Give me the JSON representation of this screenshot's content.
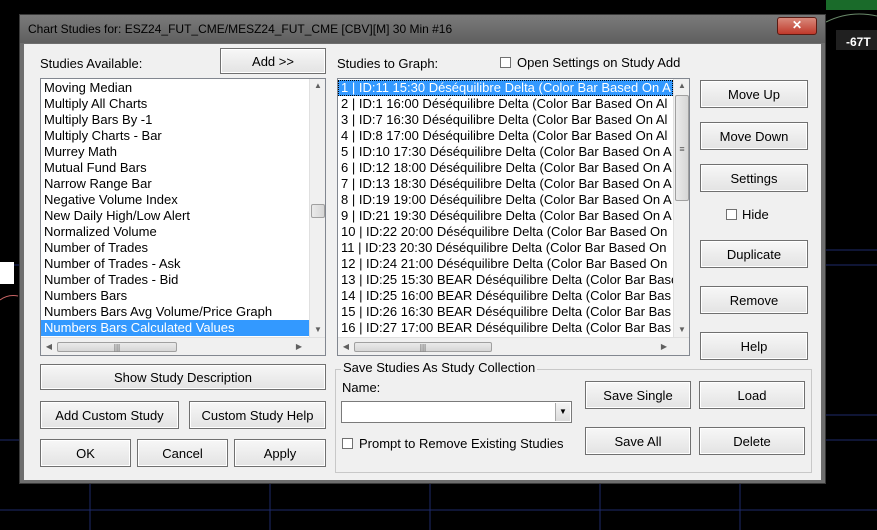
{
  "window": {
    "title": "Chart Studies for: ESZ24_FUT_CME/MESZ24_FUT_CME [CBV][M]  30 Min  #16",
    "close_label": "✕"
  },
  "background": {
    "price_tag": "-67T"
  },
  "studies_available": {
    "label": "Studies Available:",
    "items": [
      "Moving Median",
      "Multiply All Charts",
      "Multiply Bars By -1",
      "Multiply Charts - Bar",
      "Murrey Math",
      "Mutual Fund Bars",
      "Narrow Range Bar",
      "Negative Volume Index",
      "New Daily High/Low Alert",
      "Normalized Volume",
      "Number of Trades",
      "Number of Trades - Ask",
      "Number of Trades - Bid",
      "Numbers Bars",
      "Numbers Bars Avg Volume/Price Graph",
      "Numbers Bars Calculated Values"
    ],
    "selected_index": 15
  },
  "add_button": "Add >>",
  "studies_to_graph": {
    "label": "Studies to Graph:",
    "open_settings_label": "Open Settings on Study Add",
    "items": [
      "1 | ID:11  15:30 Déséquilibre Delta (Color Bar Based On A",
      "2 | ID:1  16:00 Déséquilibre Delta (Color Bar Based On Al",
      "3 | ID:7  16:30 Déséquilibre Delta (Color Bar Based On Al",
      "4 | ID:8  17:00 Déséquilibre Delta (Color Bar Based On Al",
      "5 | ID:10  17:30 Déséquilibre Delta (Color Bar Based On A",
      "6 | ID:12  18:00 Déséquilibre Delta (Color Bar Based On A",
      "7 | ID:13  18:30 Déséquilibre Delta (Color Bar Based On A",
      "8 | ID:19  19:00 Déséquilibre Delta (Color Bar Based On A",
      "9 | ID:21  19:30 Déséquilibre Delta (Color Bar Based On A",
      "10 | ID:22  20:00 Déséquilibre Delta (Color Bar Based On",
      "11 | ID:23  20:30 Déséquilibre Delta (Color Bar Based On",
      "12 | ID:24  21:00 Déséquilibre Delta (Color Bar Based On",
      "13 | ID:25  15:30 BEAR Déséquilibre Delta (Color Bar Base",
      "14 | ID:25  16:00 BEAR Déséquilibre Delta (Color Bar Bas",
      "15 | ID:26  16:30 BEAR Déséquilibre Delta (Color Bar Bas",
      "16 | ID:27  17:00 BEAR Déséquilibre Delta (Color Bar Bas"
    ],
    "selected_index": 0
  },
  "right_buttons": {
    "move_up": "Move Up",
    "move_down": "Move Down",
    "settings": "Settings",
    "hide": "Hide",
    "duplicate": "Duplicate",
    "remove": "Remove",
    "help": "Help"
  },
  "bottom_left": {
    "show_description": "Show Study Description",
    "add_custom": "Add Custom Study",
    "custom_help": "Custom Study Help",
    "ok": "OK",
    "cancel": "Cancel",
    "apply": "Apply"
  },
  "collection": {
    "group_label": "Save Studies As Study Collection",
    "name_label": "Name:",
    "name_value": "",
    "prompt_label": "Prompt to Remove Existing Studies",
    "save_single": "Save Single",
    "load": "Load",
    "save_all": "Save All",
    "delete": "Delete"
  },
  "scroll_glyphs": {
    "up": "▲",
    "down": "▼",
    "left": "◀",
    "right": "▶",
    "grip": "≡",
    "hgrip": "|||"
  }
}
